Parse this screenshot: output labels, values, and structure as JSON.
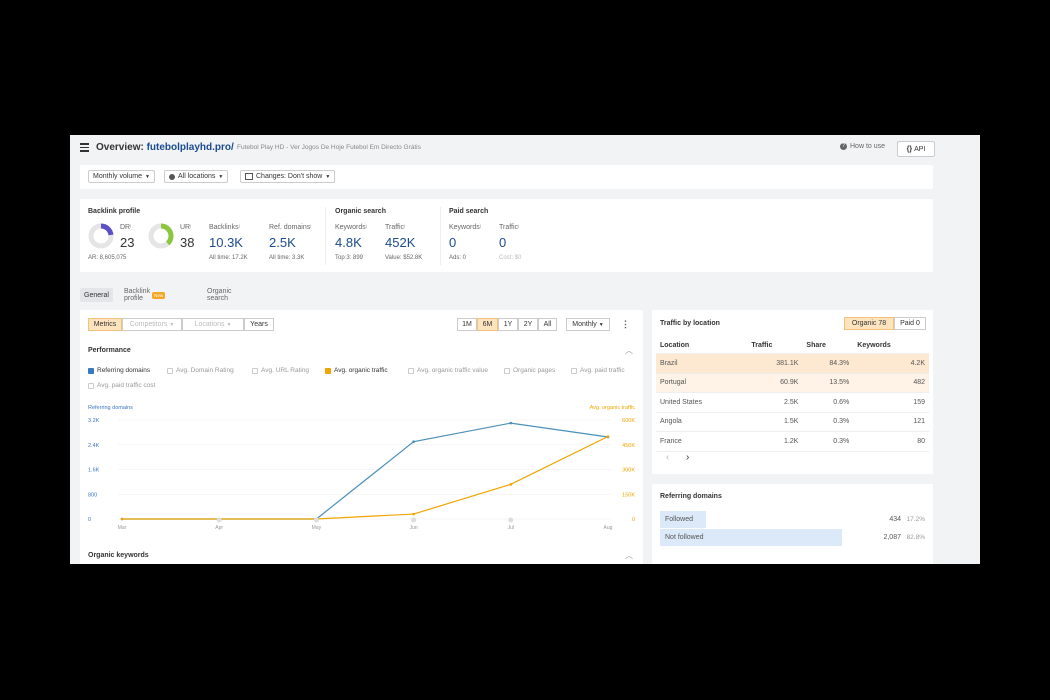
{
  "header": {
    "title_prefix": "Overview: ",
    "domain": "futebolplayhd.pro/",
    "subtitle": "Futebol Play HD - Ver Jogos De Hoje Futebol Em Directo Grátis",
    "how_to_use": "How to use",
    "api": "API"
  },
  "filters": {
    "volume": "Monthly volume",
    "locations": "All locations",
    "changes": "Changes: Don't show"
  },
  "stats": {
    "backlink_profile": "Backlink profile",
    "dr_label": "DR",
    "dr_value": "23",
    "ur_label": "UR",
    "ur_value": "38",
    "ar": "AR: 8,605,075",
    "backlinks_label": "Backlinks",
    "backlinks_value": "10.3K",
    "backlinks_sub": "All time: 17.2K",
    "refdomains_label": "Ref. domains",
    "refdomains_value": "2.5K",
    "refdomains_sub": "All time: 3.3K",
    "organic_search": "Organic search",
    "org_kw_label": "Keywords",
    "org_kw_value": "4.8K",
    "org_kw_sub": "Top 3: 899",
    "org_tr_label": "Traffic",
    "org_tr_value": "452K",
    "org_tr_sub": "Value: $52.8K",
    "paid_search": "Paid search",
    "paid_kw_label": "Keywords",
    "paid_kw_value": "0",
    "paid_kw_sub": "Ads: 0",
    "paid_tr_label": "Traffic",
    "paid_tr_value": "0",
    "paid_tr_sub": "Cost: $0"
  },
  "tabs": [
    "General",
    "Backlink profile",
    "Organic search"
  ],
  "new_badge": "New",
  "toolbar": {
    "metrics": "Metrics",
    "competitors": "Competitors",
    "locations": "Locations",
    "years": "Years",
    "ranges": [
      "1M",
      "6M",
      "1Y",
      "2Y",
      "All"
    ],
    "active_range": "6M",
    "interval": "Monthly"
  },
  "performance": {
    "title": "Performance",
    "checkboxes": [
      "Referring domains",
      "Avg. Domain Rating",
      "Avg. URL Rating",
      "Avg. organic traffic",
      "Avg. organic traffic value",
      "Organic pages",
      "Avg. paid traffic",
      "Avg. paid traffic cost"
    ],
    "organic_keywords": "Organic keywords"
  },
  "colors": {
    "blue_series": "#4a90b8",
    "orange_series": "#f0a400",
    "accent": "#1a4b8f"
  },
  "chart_data": {
    "type": "line",
    "left_axis_label": "Referring domains",
    "right_axis_label": "Avg. organic traffic",
    "x": [
      "Mar",
      "Apr",
      "May",
      "Jun",
      "Jul",
      "Aug"
    ],
    "left_ticks": [
      "3.2K",
      "2.4K",
      "1.6K",
      "800",
      "0"
    ],
    "right_ticks": [
      "600K",
      "450K",
      "300K",
      "150K",
      "0"
    ],
    "left_ylim": [
      0,
      3200
    ],
    "right_ylim": [
      0,
      600000
    ],
    "series": [
      {
        "name": "Referring domains",
        "axis": "left",
        "values": [
          0,
          0,
          0,
          2500,
          3100,
          2650
        ]
      },
      {
        "name": "Avg. organic traffic",
        "axis": "right",
        "values": [
          0,
          0,
          0,
          30000,
          210000,
          500000
        ]
      }
    ]
  },
  "traffic_by_location": {
    "title": "Traffic by location",
    "organic_tab": "Organic 78",
    "paid_tab": "Paid 0",
    "columns": [
      "Location",
      "Traffic",
      "Share",
      "Keywords"
    ],
    "rows": [
      {
        "location": "Brazil",
        "traffic": "381.1K",
        "share": "84.3%",
        "keywords": "4.2K"
      },
      {
        "location": "Portugal",
        "traffic": "60.9K",
        "share": "13.5%",
        "keywords": "482"
      },
      {
        "location": "United States",
        "traffic": "2.5K",
        "share": "0.6%",
        "keywords": "159"
      },
      {
        "location": "Angola",
        "traffic": "1.5K",
        "share": "0.3%",
        "keywords": "121"
      },
      {
        "location": "France",
        "traffic": "1.2K",
        "share": "0.3%",
        "keywords": "80"
      }
    ],
    "prev": "‹",
    "next": "›"
  },
  "referring_domains": {
    "title": "Referring domains",
    "rows": [
      {
        "label": "Followed",
        "count": "434",
        "pct": "17.2%",
        "share": 0.172
      },
      {
        "label": "Not followed",
        "count": "2,087",
        "pct": "82.8%",
        "share": 0.828
      }
    ]
  }
}
